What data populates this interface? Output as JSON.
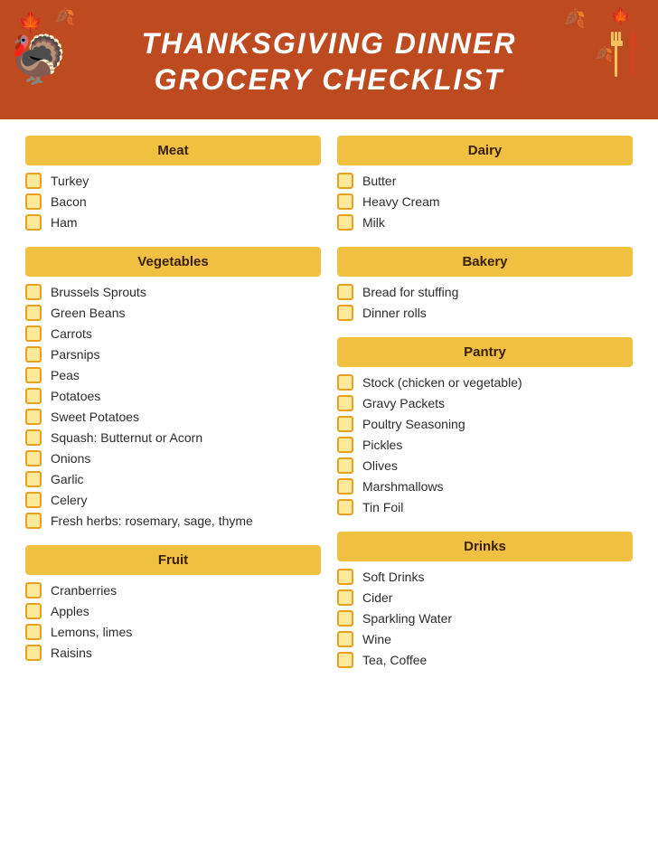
{
  "header": {
    "title_line1": "THANKSGIVING DINNER",
    "title_line2": "GROCERY CHECKLIST"
  },
  "sections": {
    "left": [
      {
        "id": "meat",
        "label": "Meat",
        "items": [
          "Turkey",
          "Bacon",
          "Ham"
        ]
      },
      {
        "id": "vegetables",
        "label": "Vegetables",
        "items": [
          "Brussels Sprouts",
          "Green Beans",
          "Carrots",
          "Parsnips",
          "Peas",
          "Potatoes",
          "Sweet Potatoes",
          "Squash: Butternut or Acorn",
          "Onions",
          "Garlic",
          "Celery",
          "Fresh herbs: rosemary, sage, thyme"
        ]
      },
      {
        "id": "fruit",
        "label": "Fruit",
        "items": [
          "Cranberries",
          "Apples",
          "Lemons, limes",
          "Raisins"
        ]
      }
    ],
    "right": [
      {
        "id": "dairy",
        "label": "Dairy",
        "items": [
          "Butter",
          "Heavy Cream",
          "Milk"
        ]
      },
      {
        "id": "bakery",
        "label": "Bakery",
        "items": [
          "Bread for stuffing",
          "Dinner rolls"
        ]
      },
      {
        "id": "pantry",
        "label": "Pantry",
        "items": [
          "Stock (chicken or vegetable)",
          "Gravy Packets",
          "Poultry Seasoning",
          "Pickles",
          "Olives",
          "Marshmallows",
          "Tin Foil"
        ]
      },
      {
        "id": "drinks",
        "label": "Drinks",
        "items": [
          "Soft Drinks",
          "Cider",
          "Sparkling Water",
          "Wine",
          "Tea, Coffee"
        ]
      }
    ]
  },
  "decorations": {
    "leaf_emoji": "🍂",
    "turkey_emoji": "🦃",
    "cutlery_label": "fork-knife"
  }
}
